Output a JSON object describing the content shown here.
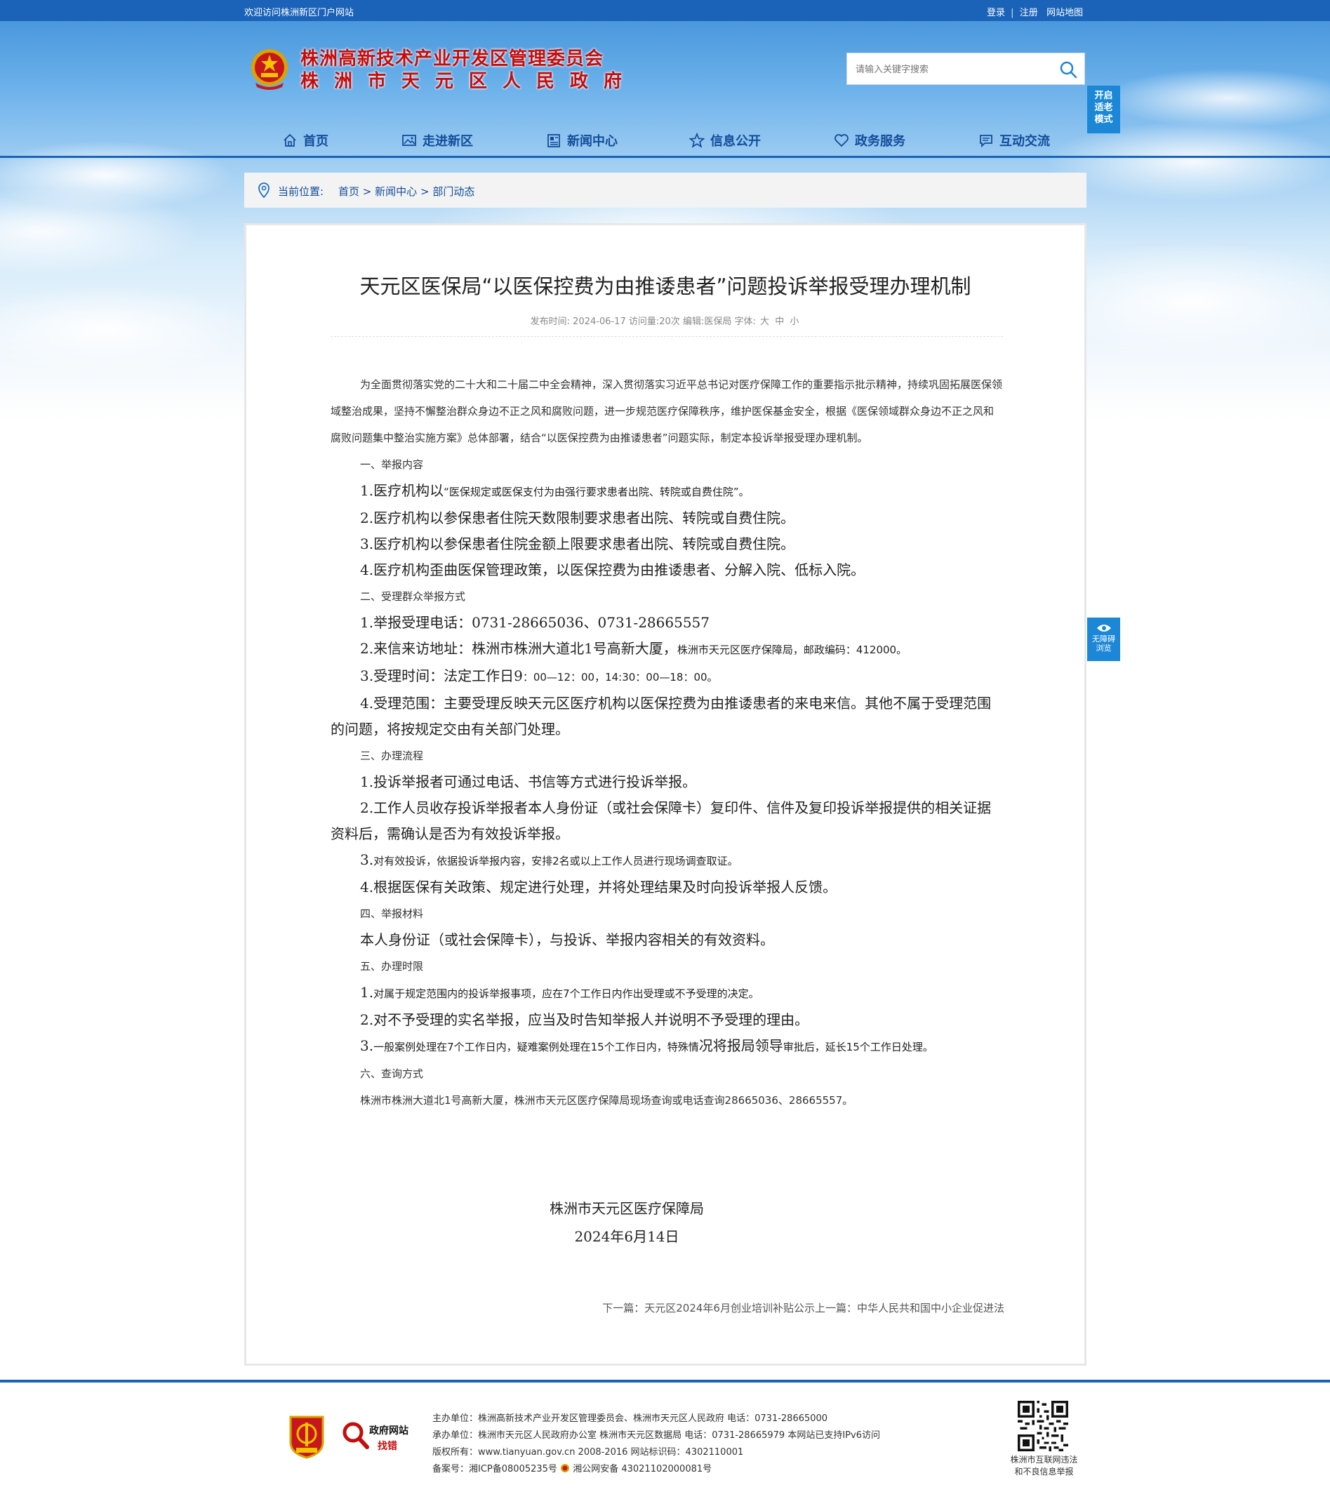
{
  "topbar": {
    "welcome": "欢迎访问株洲新区门户网站",
    "login": "登录",
    "divider": "|",
    "register": "注册",
    "sitemap": "网站地图"
  },
  "header": {
    "title_line1": "株洲高新技术产业开发区管理委员会",
    "title_line2": "株洲市天元区人民政府",
    "search_placeholder": "请输入关键字搜索",
    "elder_mode": [
      "开启",
      "适老",
      "模式"
    ]
  },
  "nav": {
    "items": [
      {
        "label": "首页",
        "icon": "home-icon"
      },
      {
        "label": "走进新区",
        "icon": "picture-icon"
      },
      {
        "label": "新闻中心",
        "icon": "newspaper-icon"
      },
      {
        "label": "信息公开",
        "icon": "star-icon"
      },
      {
        "label": "政务服务",
        "icon": "heart-icon"
      },
      {
        "label": "互动交流",
        "icon": "chat-icon"
      }
    ]
  },
  "breadcrumb": {
    "label": "当前位置:",
    "home": "首页",
    "sep": ">",
    "news": "新闻中心",
    "section": "部门动态"
  },
  "article": {
    "title": "天元区医保局“以医保控费为由推诿患者”问题投诉举报受理办理机制",
    "meta": {
      "publish_label": "发布时间:",
      "publish_date": "2024-06-17",
      "views_label": "访问量:",
      "views": "20次",
      "editor_label": "编辑:",
      "editor": "医保局",
      "font_label": "字体:",
      "font_big": "大",
      "font_mid": "中",
      "font_small": "小"
    },
    "intro": "为全面贯彻落实党的二十大和二十届二中全会精神，深入贯彻落实习近平总书记对医疗保障工作的重要指示批示精神，持续巩固拓展医保领域整治成果，坚持不懈整治群众身边不正之风和腐败问题，进一步规范医疗保障秩序，维护医保基金安全，根据《医保领域群众身边不正之风和腐败问题集中整治实施方案》总体部署，结合“以医保控费为由推诿患者”问题实际，制定本投诉举报受理办理机制。",
    "s1_title": "一、举报内容",
    "s1_1a": "1.医疗机构以",
    "s1_1b": "“医保规定或医保支付为由强行要求患者出院、转院或自费住院”。",
    "s1_2": "2.医疗机构以参保患者住院天数限制要求患者出院、转院或自费住院。",
    "s1_3": "3.医疗机构以参保患者住院金额上限要求患者出院、转院或自费住院。",
    "s1_4": "4.医疗机构歪曲医保管理政策，以医保控费为由推诿患者、分解入院、低标入院。",
    "s2_title": "二、受理群众举报方式",
    "s2_1": "1.举报受理电话：0731-28665036、0731-28665557",
    "s2_2a": "2.来信来访地址：株洲市株洲大道北1号高新大厦，",
    "s2_2b": "株洲市天元区医疗保障局，邮政编码：412000。",
    "s2_3a": "3.受理时间：法定工作日9",
    "s2_3b": "：00—12：00，14:30：00—18：00。",
    "s2_4": "4.受理范围：主要受理反映天元区医疗机构以医保控费为由推诿患者的来电来信。其他不属于受理范围的问题，将按规定交由有关部门处理。",
    "s3_title": "三、办理流程",
    "s3_1": "1.投诉举报者可通过电话、书信等方式进行投诉举报。",
    "s3_2": "2.工作人员收存投诉举报者本人身份证（或社会保障卡）复印件、信件及复印投诉举报提供的相关证据资料后，需确认是否为有效投诉举报。",
    "s3_3a": "3.",
    "s3_3b": "对有效投诉，依据投诉举报内容，安排2名或以上工作人员进行现场调查取证。",
    "s3_4": "4.根据医保有关政策、规定进行处理，并将处理结果及时向投诉举报人反馈。",
    "s4_title": "四、举报材料",
    "s4_1": "本人身份证（或社会保障卡），与投诉、举报内容相关的有效资料。",
    "s5_title": "五、办理时限",
    "s5_1a": "1.",
    "s5_1b": "对属于规定范围内的投诉举报事项，应在7个工作日内作出受理或不予受理的决定。",
    "s5_2": "2.对不予受理的实名举报，应当及时告知举报人并说明不予受理的理由。",
    "s5_3a": "3.",
    "s5_3b": "一般案例处理在7个工作日内，疑难案例处理在15个工作日内，特殊情",
    "s5_3c": "况将报局领导",
    "s5_3d": "审批后，延长15个工作日处理。",
    "s6_title": "六、查询方式",
    "s6_1": "株洲市株洲大道北1号高新大厦，株洲市天元区医疗保障局现场查询或电话查询28665036、28665557。",
    "sign_org": "株洲市天元区医疗保障局",
    "sign_date": "2024年6月14日",
    "next_label": "下一篇：",
    "next_title": "天元区2024年6月创业培训补贴公示",
    "prev_label": "上一篇：",
    "prev_title": "中华人民共和国中小企业促进法"
  },
  "accessibility": {
    "line1": "无障碍",
    "line2": "浏览"
  },
  "footer": {
    "gov_badge_line1": "政府网站",
    "gov_badge_line2": "找错",
    "sponsor": "主办单位：株洲高新技术产业开发区管理委员会、株洲市天元区人民政府 电话：0731-28665000",
    "organizer": "承办单位：株洲市天元区人民政府办公室 株洲市天元区数据局 电话：0731-28665979 本网站已支持IPv6访问",
    "copyright": "版权所有：www.tianyuan.gov.cn 2008-2016 网站标识码：4302110001",
    "icp": "备案号：湘ICP备08005235号",
    "police": "湘公网安备 43021102000081号",
    "qr_caption1": "株洲市互联网违法",
    "qr_caption2": "和不良信息举报"
  },
  "colors": {
    "brand_blue": "#1a63b8",
    "title_red": "#c40d0d",
    "nav_text": "#124d9a",
    "side_button": "#1b87d6"
  }
}
